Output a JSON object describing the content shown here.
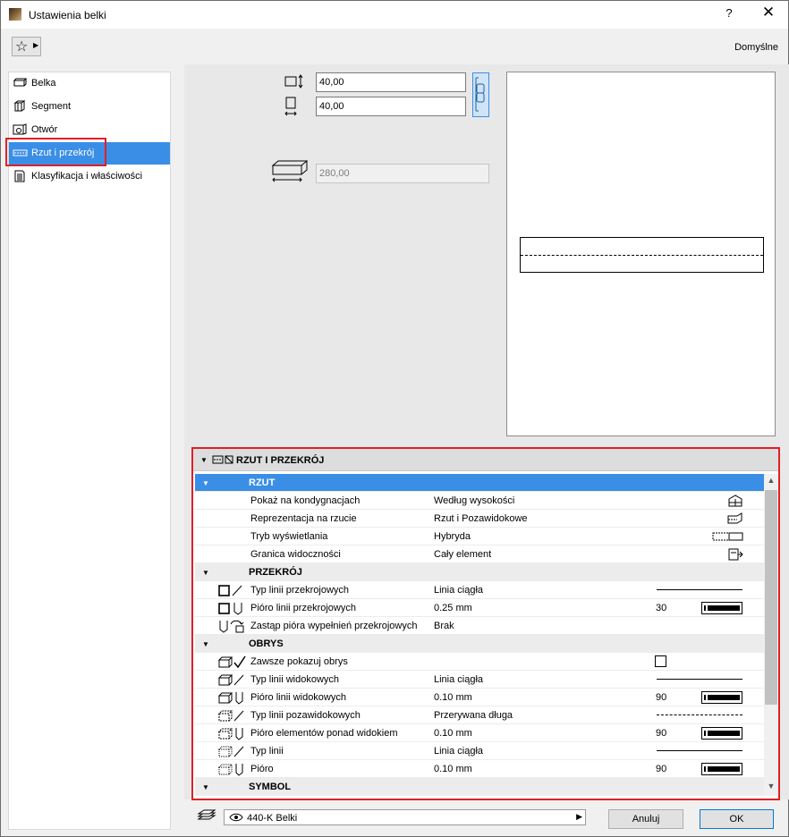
{
  "window": {
    "title": "Ustawienia belki",
    "help_label": "?",
    "close_label": "✕"
  },
  "toolbar": {
    "favorites_icon": "star-icon",
    "defaults_label": "Domyślne"
  },
  "sidebar": {
    "items": [
      {
        "label": "Belka",
        "icon": "beam-icon"
      },
      {
        "label": "Segment",
        "icon": "segment-icon"
      },
      {
        "label": "Otwór",
        "icon": "opening-icon"
      },
      {
        "label": "Rzut i przekrój",
        "icon": "floorplan-section-icon",
        "selected": true
      },
      {
        "label": "Klasyfikacja i właściwości",
        "icon": "classification-icon"
      }
    ]
  },
  "geometry": {
    "width_value": "40,00",
    "height_value": "40,00",
    "length_value": "280,00"
  },
  "panel": {
    "title": "RZUT I PRZEKRÓJ",
    "sections": {
      "rzut": "RZUT",
      "przekroj": "PRZEKRÓJ",
      "obrys": "OBRYS",
      "symbol": "SYMBOL"
    },
    "rows": {
      "show_on_stories": {
        "label": "Pokaż na kondygnacjach",
        "value": "Według wysokości"
      },
      "floor_plan_display": {
        "label": "Reprezentacja na rzucie",
        "value": "Rzut i Pozawidokowe"
      },
      "display_mode": {
        "label": "Tryb wyświetlania",
        "value": "Hybryda"
      },
      "show_projection": {
        "label": "Granica widoczności",
        "value": "Cały element"
      },
      "cut_line_type": {
        "label": "Typ linii przekrojowych",
        "value": "Linia ciągła"
      },
      "cut_line_pen": {
        "label": "Pióro linii przekrojowych",
        "value": "0.25 mm",
        "pen": "30"
      },
      "override_cut_fill_pens": {
        "label": "Zastąp pióra wypełnień przekrojowych",
        "value": "Brak"
      },
      "always_show_outline": {
        "label": "Zawsze pokazuj obrys"
      },
      "uncut_line_type": {
        "label": "Typ linii widokowych",
        "value": "Linia ciągła"
      },
      "uncut_line_pen": {
        "label": "Pióro linii widokowych",
        "value": "0.10 mm",
        "pen": "90"
      },
      "overhead_line_type": {
        "label": "Typ linii pozawidokowych",
        "value": "Przerywana długa"
      },
      "overhead_line_pen": {
        "label": "Pióro elementów ponad widokiem",
        "value": "0.10 mm",
        "pen": "90"
      },
      "hidden_line_type": {
        "label": "Typ linii",
        "value": "Linia ciągła"
      },
      "hidden_line_pen": {
        "label": "Pióro",
        "value": "0.10 mm",
        "pen": "90"
      }
    }
  },
  "footer": {
    "layer_value": "440-K Belki",
    "cancel_label": "Anuluj",
    "ok_label": "OK"
  }
}
